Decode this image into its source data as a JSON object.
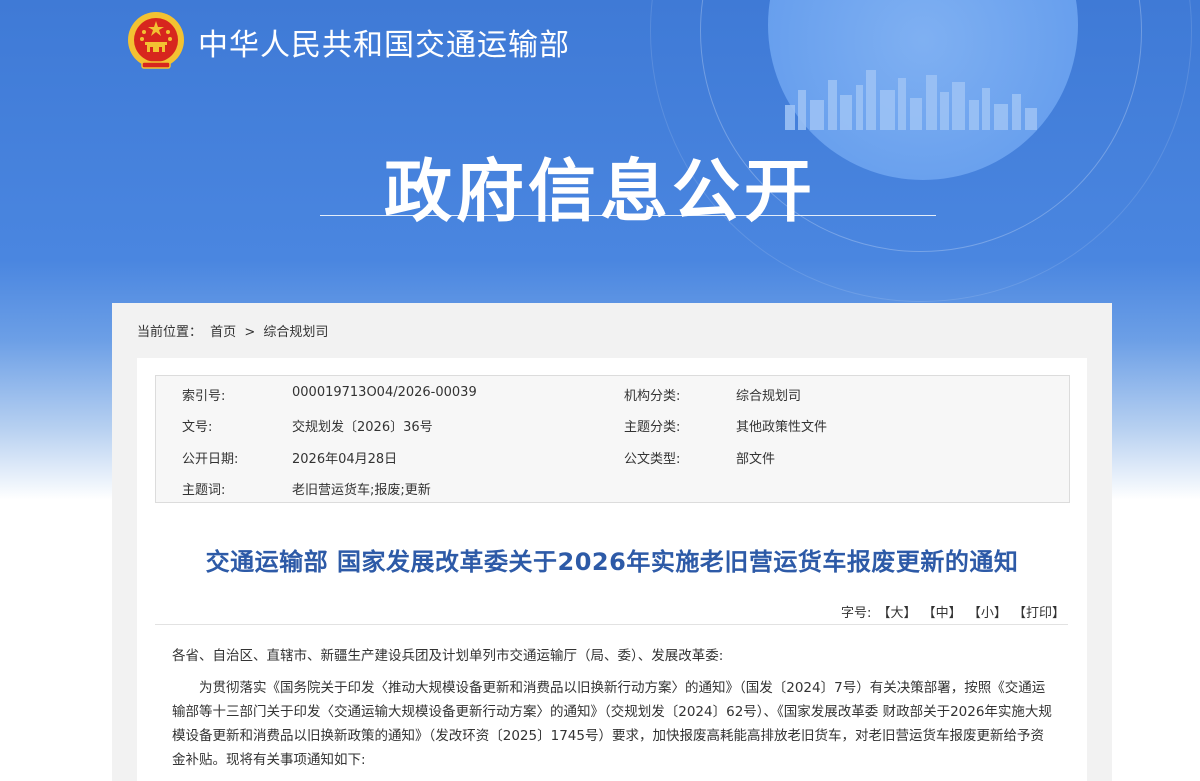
{
  "header": {
    "site_name": "中华人民共和国交通运输部",
    "banner_title": "政府信息公开"
  },
  "breadcrumb": {
    "prefix": "当前位置：",
    "items": [
      "首页",
      "综合规划司"
    ],
    "separator": ">"
  },
  "meta": {
    "index_label": "索引号:",
    "index_value": "000019713O04/2026-00039",
    "org_label": "机构分类:",
    "org_value": "综合规划司",
    "docno_label": "文号:",
    "docno_value": "交规划发〔2026〕36号",
    "theme_label": "主题分类:",
    "theme_value": "其他政策性文件",
    "date_label": "公开日期:",
    "date_value": "2026年04月28日",
    "type_label": "公文类型:",
    "type_value": "部文件",
    "keywords_label": "主题词:",
    "keywords_value": "老旧营运货车;报废;更新"
  },
  "document": {
    "title": "交通运输部 国家发展改革委关于2026年实施老旧营运货车报废更新的通知",
    "font_size_label": "字号:",
    "font_large": "【大】",
    "font_medium": "【中】",
    "font_small": "【小】",
    "print": "【打印】",
    "greeting": "各省、自治区、直辖市、新疆生产建设兵团及计划单列市交通运输厅（局、委）、发展改革委:",
    "paragraph1": "为贯彻落实《国务院关于印发〈推动大规模设备更新和消费品以旧换新行动方案〉的通知》（国发〔2024〕7号）有关决策部署，按照《交通运输部等十三部门关于印发〈交通运输大规模设备更新行动方案〉的通知》（交规划发〔2024〕62号）、《国家发展改革委 财政部关于2026年实施大规模设备更新和消费品以旧换新政策的通知》（发改环资〔2025〕1745号）要求，加快报废高耗能高排放老旧货车，对老旧营运货车报废更新给予资金补贴。现将有关事项通知如下:"
  },
  "colors": {
    "banner_blue": "#4a86e0",
    "title_blue": "#2d5aa7",
    "emblem_red": "#d7261e",
    "emblem_gold": "#f3c232"
  }
}
